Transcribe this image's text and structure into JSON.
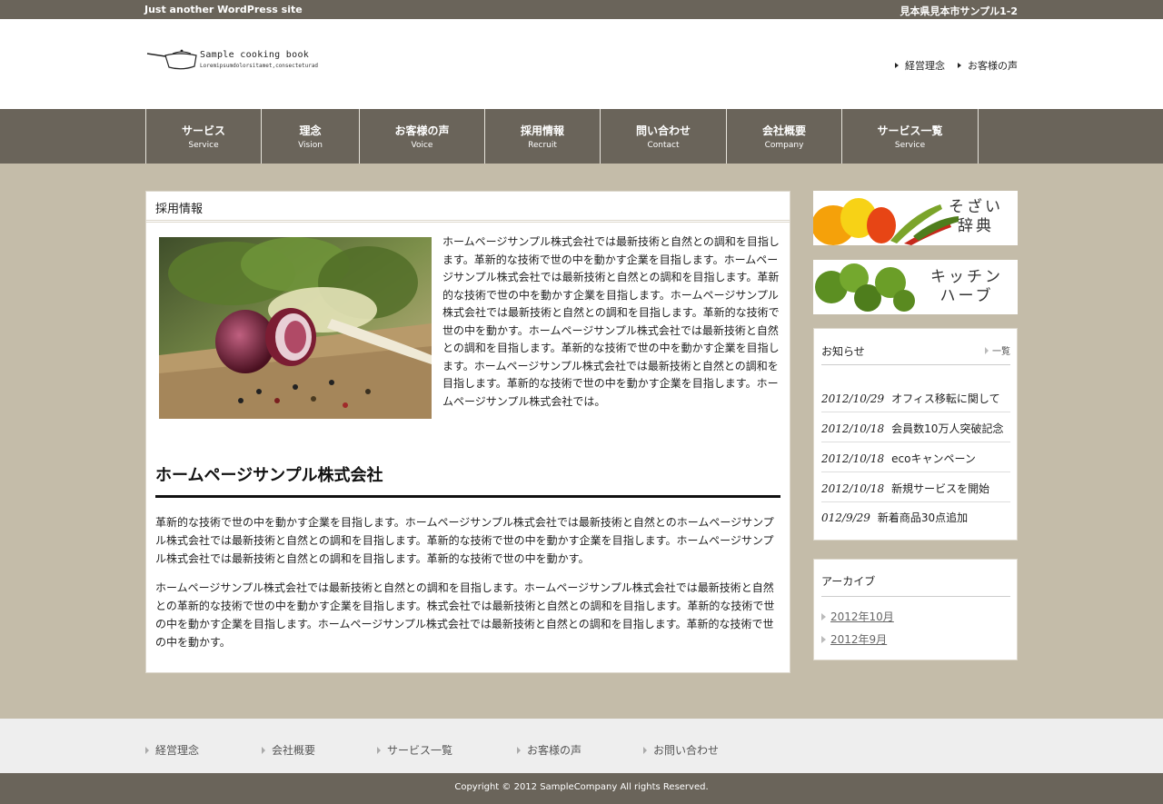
{
  "topbar": {
    "tagline": "Just another WordPress site",
    "address": "見本県見本市サンプル1-2"
  },
  "logo": {
    "title": "Sample cooking book",
    "subtitle": "Loremipsumdolorsitamet,consecteturad"
  },
  "header_links": [
    "経営理念",
    "お客様の声"
  ],
  "nav": [
    {
      "jp": "サービス",
      "en": "Service"
    },
    {
      "jp": "理念",
      "en": "Vision"
    },
    {
      "jp": "お客様の声",
      "en": "Voice"
    },
    {
      "jp": "採用情報",
      "en": "Recruit"
    },
    {
      "jp": "問い合わせ",
      "en": "Contact"
    },
    {
      "jp": "会社概要",
      "en": "Company"
    },
    {
      "jp": "サービス一覧",
      "en": "Service"
    }
  ],
  "main": {
    "title": "採用情報",
    "intro": "ホームページサンプル株式会社では最新技術と自然との調和を目指します。革新的な技術で世の中を動かす企業を目指します。ホームページサンプル株式会社では最新技術と自然との調和を目指します。革新的な技術で世の中を動かす企業を目指します。ホームページサンプル株式会社では最新技術と自然との調和を目指します。革新的な技術で世の中を動かす。ホームページサンプル株式会社では最新技術と自然との調和を目指します。革新的な技術で世の中を動かす企業を目指します。ホームページサンプル株式会社では最新技術と自然との調和を目指します。革新的な技術で世の中を動かす企業を目指します。ホームページサンプル株式会社では。",
    "section_title": "ホームページサンプル株式会社",
    "para1": "革新的な技術で世の中を動かす企業を目指します。ホームページサンプル株式会社では最新技術と自然とのホームページサンプル株式会社では最新技術と自然との調和を目指します。革新的な技術で世の中を動かす企業を目指します。ホームページサンプル株式会社では最新技術と自然との調和を目指します。革新的な技術で世の中を動かす。",
    "para2": "ホームページサンプル株式会社では最新技術と自然との調和を目指します。ホームページサンプル株式会社では最新技術と自然との革新的な技術で世の中を動かす企業を目指します。株式会社では最新技術と自然との調和を目指します。革新的な技術で世の中を動かす企業を目指します。ホームページサンプル株式会社では最新技術と自然との調和を目指します。革新的な技術で世の中を動かす。"
  },
  "banners": {
    "banner1_line1": "そざい",
    "banner1_line2": "辞典",
    "banner2_line1": "キッチン",
    "banner2_line2": "ハーブ"
  },
  "news": {
    "title": "お知らせ",
    "more": "一覧",
    "items": [
      {
        "date": "2012/10/29",
        "text": "オフィス移転に関して"
      },
      {
        "date": "2012/10/18",
        "text": "会員数10万人突破記念"
      },
      {
        "date": "2012/10/18",
        "text": "ecoキャンペーン"
      },
      {
        "date": "2012/10/18",
        "text": "新規サービスを開始"
      },
      {
        "date": "012/9/29",
        "text": "新着商品30点追加"
      }
    ]
  },
  "archive": {
    "title": "アーカイブ",
    "items": [
      "2012年10月",
      "2012年9月"
    ]
  },
  "footer_links": [
    "経営理念",
    "会社概要",
    "サービス一覧",
    "お客様の声",
    "お問い合わせ"
  ],
  "copyright": "Copyright © 2012 SampleCompany All rights Reserved."
}
